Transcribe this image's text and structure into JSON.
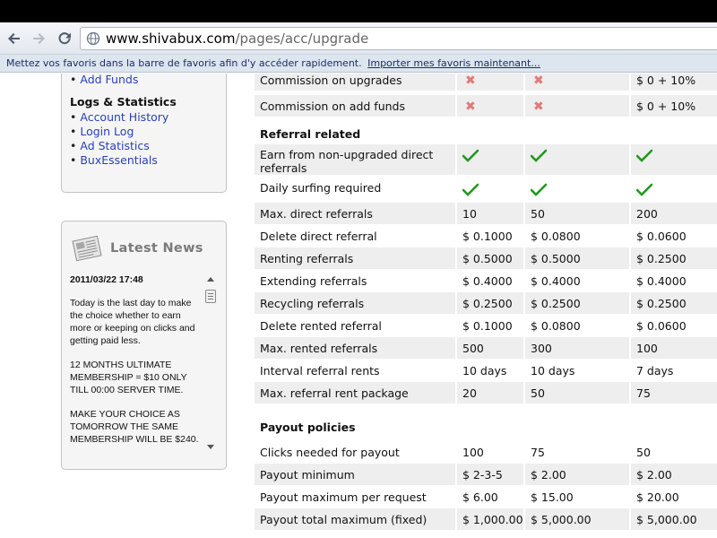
{
  "browser": {
    "url_host": "www.shivabux.com",
    "url_path": "/pages/acc/upgrade",
    "bookmarks_text": "Mettez vos favoris dans la barre de favoris afin d'y accéder rapidement.",
    "bookmarks_link": "Importer mes favoris maintenant..."
  },
  "sidebar": {
    "top_item": "Add Funds",
    "logs_heading": "Logs & Statistics",
    "logs_items": [
      "Account History",
      "Login Log",
      "Ad Statistics",
      "BuxEssentials"
    ]
  },
  "news": {
    "title": "Latest News",
    "date": "2011/03/22 17:48",
    "paragraphs": [
      "Today is the last day to make the choice whether to earn more or keeping on clicks and getting paid less.",
      "12 MONTHS ULTIMATE MEMBERSHIP = $10 ONLY TILL 00:00 SERVER TIME.",
      "MAKE YOUR CHOICE AS TOMORROW THE SAME MEMBERSHIP WILL BE $240."
    ]
  },
  "table": {
    "commission_rows": [
      {
        "label": "Commission on upgrades",
        "c3": "$ 0 + 10%"
      },
      {
        "label": "Commission on add funds",
        "c3": "$ 0 + 10%"
      }
    ],
    "referral_heading": "Referral related",
    "referral_check_rows": [
      "Earn from non-upgraded direct referrals",
      "Daily surfing required"
    ],
    "referral_rows": [
      {
        "label": "Max. direct referrals",
        "c1": "10",
        "c2": "50",
        "c3": "200"
      },
      {
        "label": "Delete direct referral",
        "c1": "$ 0.1000",
        "c2": "$ 0.0800",
        "c3": "$ 0.0600"
      },
      {
        "label": "Renting referrals",
        "c1": "$ 0.5000",
        "c2": "$ 0.5000",
        "c3": "$ 0.2500"
      },
      {
        "label": "Extending referrals",
        "c1": "$ 0.4000",
        "c2": "$ 0.4000",
        "c3": "$ 0.4000"
      },
      {
        "label": "Recycling referrals",
        "c1": "$ 0.2500",
        "c2": "$ 0.2500",
        "c3": "$ 0.2500"
      },
      {
        "label": "Delete rented referral",
        "c1": "$ 0.1000",
        "c2": "$ 0.0800",
        "c3": "$ 0.0600"
      },
      {
        "label": "Max. rented referrals",
        "c1": "500",
        "c2": "300",
        "c3": "100"
      },
      {
        "label": "Interval referral rents",
        "c1": "10 days",
        "c2": "10 days",
        "c3": "7 days"
      },
      {
        "label": "Max. referral rent package",
        "c1": "20",
        "c2": "50",
        "c3": "75"
      }
    ],
    "payout_heading": "Payout policies",
    "payout_rows": [
      {
        "label": "Clicks needed for payout",
        "c1": "100",
        "c2": "75",
        "c3": "50"
      },
      {
        "label": "Payout minimum",
        "c1": "$ 2-3-5",
        "c2": "$ 2.00",
        "c3": "$ 2.00"
      },
      {
        "label": "Payout maximum per request",
        "c1": "$ 6.00",
        "c2": "$ 15.00",
        "c3": "$ 20.00"
      },
      {
        "label": "Payout total maximum (fixed)",
        "c1": "$ 1,000.00",
        "c2": "$ 5,000.00",
        "c3": "$ 5,000.00"
      }
    ]
  },
  "colors": {
    "check": "#1f9a1f",
    "xmark": "#e07a7a",
    "link": "#2a3fb8"
  }
}
